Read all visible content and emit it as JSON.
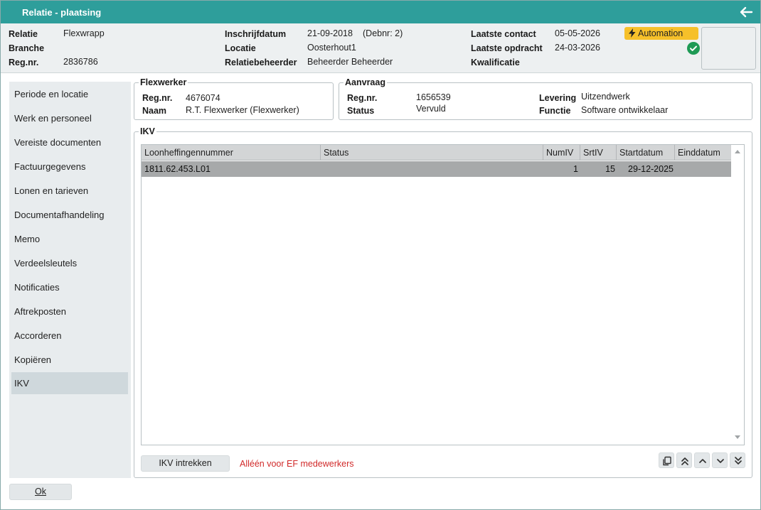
{
  "window": {
    "title": "Relatie - plaatsing"
  },
  "header": {
    "relatie_label": "Relatie",
    "relatie_value": "Flexwrapp",
    "branche_label": "Branche",
    "regnr_label": "Reg.nr.",
    "regnr_value": "2836786",
    "inschrijfdatum_label": "Inschrijfdatum",
    "inschrijfdatum_value": "21-09-2018",
    "debnr_value": "(Debnr: 2)",
    "locatie_label": "Locatie",
    "locatie_value": "Oosterhout1",
    "relatiebeheerder_label": "Relatiebeheerder",
    "relatiebeheerder_value": "Beheerder Beheerder",
    "laatste_contact_label": "Laatste contact",
    "laatste_contact_value": "05-05-2026",
    "laatste_opdracht_label": "Laatste opdracht",
    "laatste_opdracht_value": "24-03-2026",
    "kwalificatie_label": "Kwalificatie",
    "automation_badge": "Automation",
    "colors": {
      "titlebar": "#2e9e9b",
      "badge": "#f6c02a",
      "check": "#1e9a55"
    }
  },
  "sidebar": {
    "items": [
      {
        "label": "Periode en locatie"
      },
      {
        "label": "Werk en personeel"
      },
      {
        "label": "Vereiste documenten"
      },
      {
        "label": "Factuurgegevens"
      },
      {
        "label": "Lonen en tarieven"
      },
      {
        "label": "Documentafhandeling"
      },
      {
        "label": "Memo"
      },
      {
        "label": "Verdeelsleutels"
      },
      {
        "label": "Notificaties"
      },
      {
        "label": "Aftrekposten"
      },
      {
        "label": "Accorderen"
      },
      {
        "label": "Kopiëren"
      },
      {
        "label": "IKV"
      }
    ],
    "active": "IKV"
  },
  "flexwerker": {
    "legend": "Flexwerker",
    "regnr_label": "Reg.nr.",
    "regnr_value": "4676074",
    "naam_label": "Naam",
    "naam_value": "R.T. Flexwerker (Flexwerker)"
  },
  "aanvraag": {
    "legend": "Aanvraag",
    "regnr_label": "Reg.nr.",
    "regnr_value": "1656539",
    "status_label": "Status",
    "status_value": "Vervuld",
    "levering_label": "Levering",
    "levering_value": "Uitzendwerk",
    "functie_label": "Functie",
    "functie_value": "Software ontwikkelaar"
  },
  "ikv": {
    "legend": "IKV",
    "columns": [
      "Loonheffingennummer",
      "Status",
      "NumIV",
      "SrtIV",
      "Startdatum",
      "Einddatum"
    ],
    "rows": [
      {
        "loonheffingennummer": "1811.62.453.L01",
        "status": "",
        "numiv": "1",
        "srtiv": "15",
        "startdatum": "29-12-2025",
        "einddatum": ""
      }
    ],
    "intrekken_button": "IKV intrekken",
    "warning": "Alléén voor EF medewerkers"
  },
  "footer": {
    "ok_button": "Ok"
  }
}
